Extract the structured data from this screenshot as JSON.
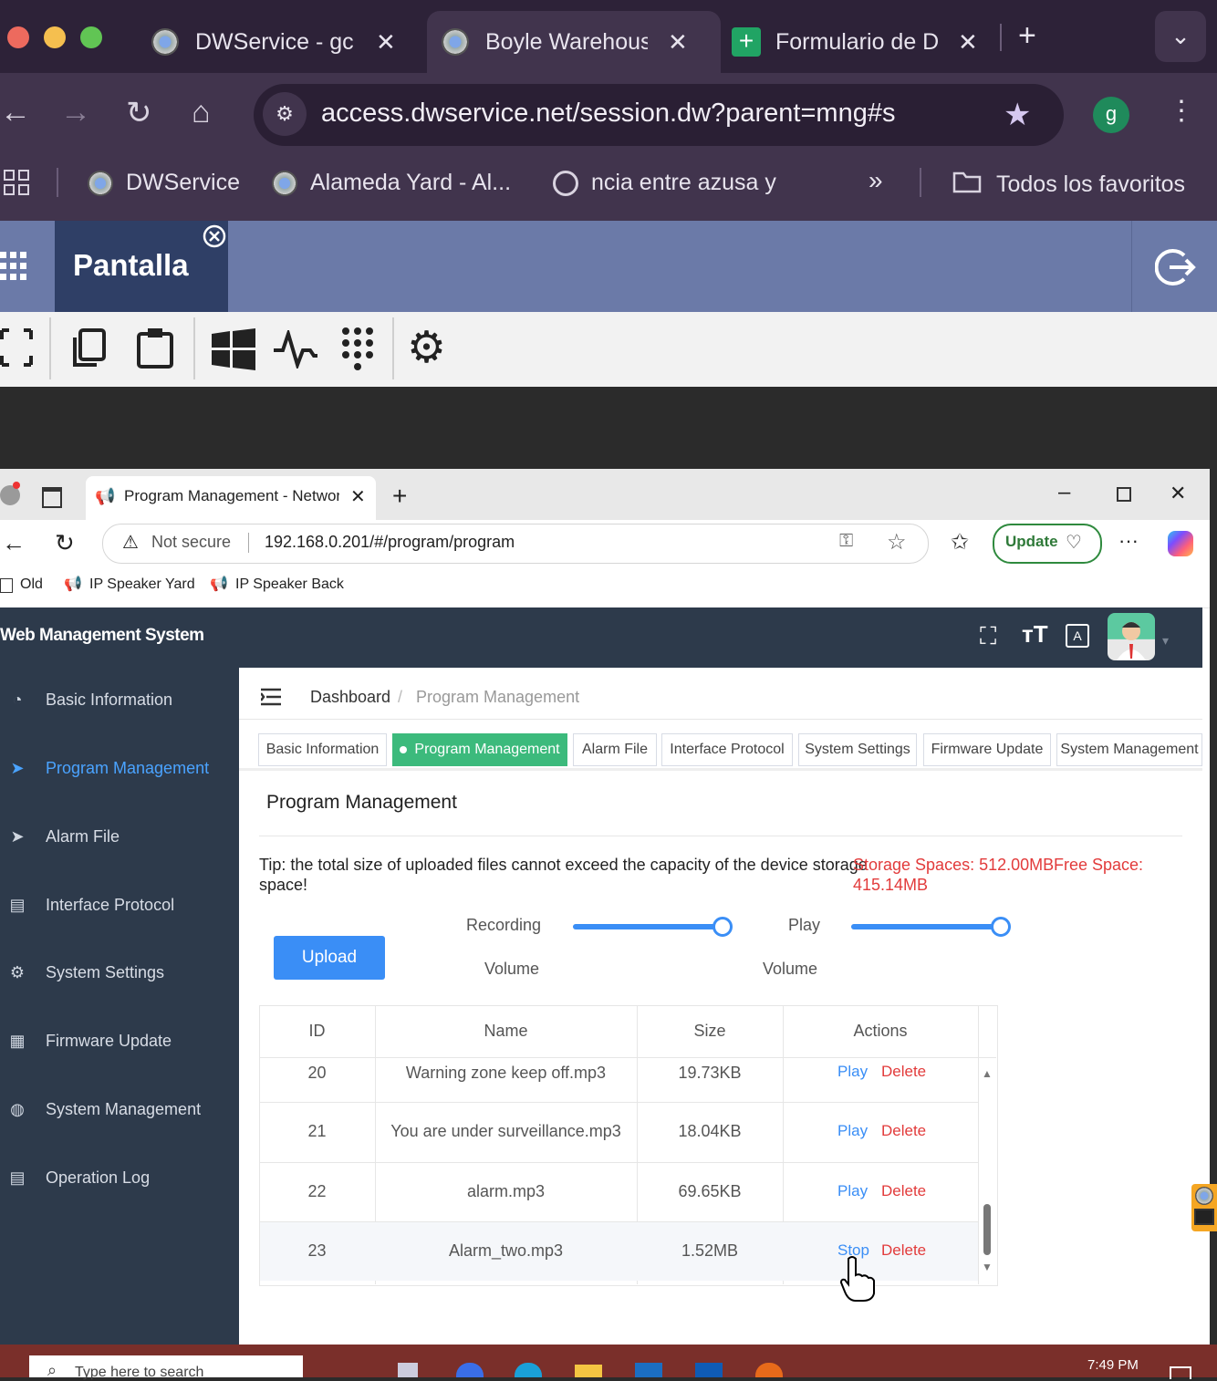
{
  "outer_browser": {
    "tabs": [
      {
        "title": "DWService - gc",
        "active": false
      },
      {
        "title": "Boyle Warehous",
        "active": true
      },
      {
        "title": "Formulario de D",
        "active": false
      }
    ],
    "url": "access.dwservice.net/session.dw?parent=mng#s",
    "profile_initial": "g",
    "bookmarks": [
      "DWService",
      "Alameda Yard - Al...",
      "ncia entre azusa y"
    ],
    "bookmarks_more": "»",
    "all_bookmarks": "Todos los favoritos"
  },
  "dwservice": {
    "tab_label": "Pantalla"
  },
  "inner_browser": {
    "tab_title": "Program Management - Network",
    "not_secure": "Not secure",
    "url": "192.168.0.201/#/program/program",
    "update_label": "Update",
    "bookmarks": [
      "Old",
      "IP Speaker Yard",
      "IP Speaker Back"
    ]
  },
  "app": {
    "title": "Web Management System",
    "sidebar": [
      {
        "label": "Basic Information",
        "icon": "dashboard-icon",
        "active": false
      },
      {
        "label": "Program Management",
        "icon": "send-icon",
        "active": true
      },
      {
        "label": "Alarm File",
        "icon": "send-icon",
        "active": false
      },
      {
        "label": "Interface Protocol",
        "icon": "document-icon",
        "active": false
      },
      {
        "label": "System Settings",
        "icon": "gear-icon",
        "active": false
      },
      {
        "label": "Firmware Update",
        "icon": "grid-icon",
        "active": false
      },
      {
        "label": "System Management",
        "icon": "globe-icon",
        "active": false
      },
      {
        "label": "Operation Log",
        "icon": "log-icon",
        "active": false
      }
    ],
    "breadcrumb": {
      "home": "Dashboard",
      "separator": "/",
      "current": "Program Management"
    },
    "page_tabs": [
      {
        "label": "Basic Information",
        "active": false
      },
      {
        "label": "Program Management",
        "active": true
      },
      {
        "label": "Alarm File",
        "active": false
      },
      {
        "label": "Interface Protocol",
        "active": false
      },
      {
        "label": "System Settings",
        "active": false
      },
      {
        "label": "Firmware Update",
        "active": false
      },
      {
        "label": "System Management",
        "active": false
      }
    ],
    "section_title": "Program Management",
    "tip_line1": "Tip: the total size of uploaded files cannot exceed the capacity of the device storage",
    "tip_line2": "space!",
    "storage": "Storage Spaces: 512.00MB",
    "free_space_label": "Free Space:",
    "free_space_value": "415.14MB",
    "upload_label": "Upload",
    "recording_label": "Recording",
    "recording_sub": "Volume",
    "play_label": "Play",
    "play_sub": "Volume",
    "recording_volume": 1.0,
    "play_volume": 1.0,
    "table": {
      "headers": [
        "ID",
        "Name",
        "Size",
        "Actions"
      ],
      "rows": [
        {
          "id": "20",
          "name": "Warning zone keep off.mp3",
          "size": "19.73KB",
          "action1": "Play",
          "action2": "Delete"
        },
        {
          "id": "21",
          "name": "You are under surveillance.mp3",
          "size": "18.04KB",
          "action1": "Play",
          "action2": "Delete"
        },
        {
          "id": "22",
          "name": "alarm.mp3",
          "size": "69.65KB",
          "action1": "Play",
          "action2": "Delete"
        },
        {
          "id": "23",
          "name": "Alarm_two.mp3",
          "size": "1.52MB",
          "action1": "Stop",
          "action2": "Delete"
        }
      ]
    }
  },
  "taskbar": {
    "search": "Type here to search",
    "time": "7:49 PM"
  },
  "colors": {
    "outer_chrome": "#2d2238",
    "dw_header": "#6b7aa8",
    "sidebar": "#2d3a4b",
    "accent_blue": "#3a8ef6",
    "active_tab_green": "#3cba7c",
    "danger_red": "#e23b3b"
  }
}
